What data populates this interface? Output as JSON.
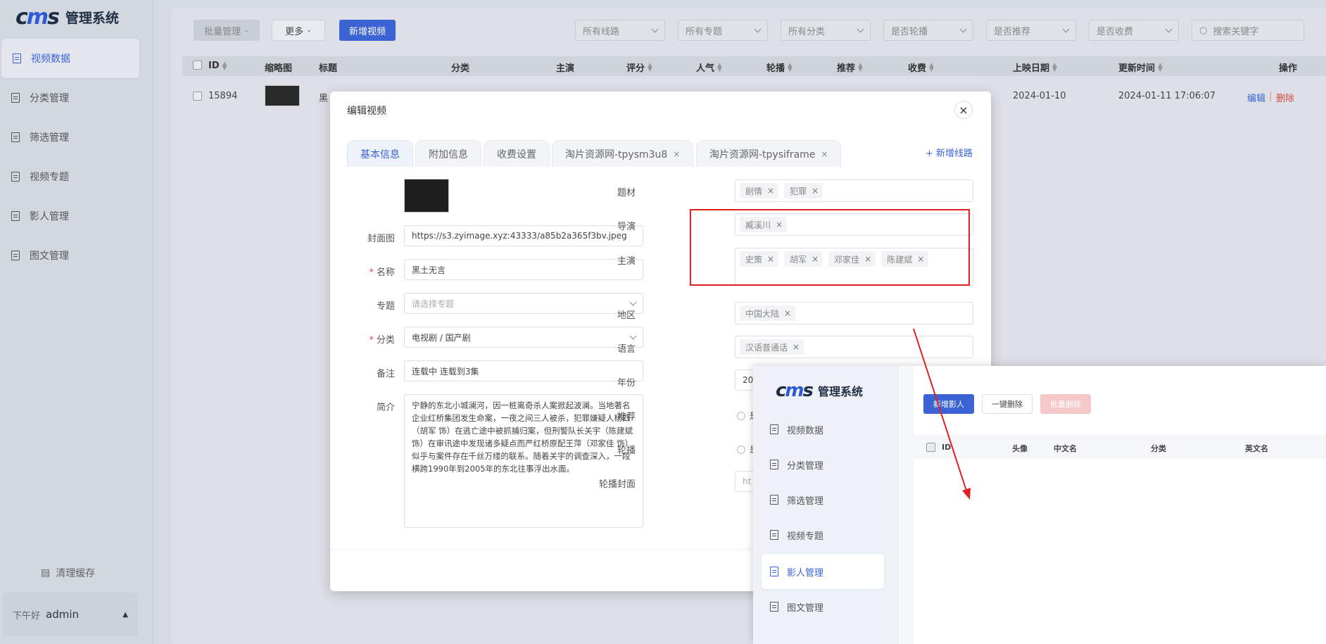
{
  "app": {
    "logo_mark": "cms",
    "title": "管理系统"
  },
  "sidebar": {
    "items": [
      {
        "label": "视频数据"
      },
      {
        "label": "分类管理"
      },
      {
        "label": "筛选管理"
      },
      {
        "label": "视频专题"
      },
      {
        "label": "影人管理"
      },
      {
        "label": "图文管理"
      }
    ],
    "clear_cache": "清理缓存",
    "greeting": "下午好",
    "username": "admin"
  },
  "toolbar": {
    "batch": "批量管理",
    "more": "更多",
    "add_video": "新增视频",
    "filters": [
      "所有线路",
      "所有专题",
      "所有分类",
      "是否轮播",
      "是否推荐",
      "是否收费"
    ],
    "search_placeholder": "搜索关键字"
  },
  "table": {
    "headers": [
      "ID",
      "缩略图",
      "标题",
      "分类",
      "主演",
      "评分",
      "人气",
      "轮播",
      "推荐",
      "收费",
      "上映日期",
      "更新时间",
      "操作"
    ],
    "row": {
      "id": "15894",
      "title_partial": "黑",
      "release_date": "2024-01-10",
      "updated": "2024-01-11 17:06:07",
      "edit": "编辑",
      "divider": "|",
      "delete": "删除"
    }
  },
  "modal": {
    "title": "编辑视频",
    "close": "×",
    "tabs": [
      {
        "label": "基本信息"
      },
      {
        "label": "附加信息"
      },
      {
        "label": "收费设置"
      },
      {
        "label": "淘片资源网-tpysm3u8",
        "close": "×"
      },
      {
        "label": "淘片资源网-tpysiframe",
        "close": "×"
      }
    ],
    "add_line": "+ 新增线路",
    "fields": {
      "cover_label": "封面图",
      "cover_value": "https://s3.zyimage.xyz:43333/a85b2a365f3bv.jpeg",
      "name_label": "名称",
      "name_value": "黑土无言",
      "topic_label": "专题",
      "topic_placeholder": "请选择专题",
      "category_label": "分类",
      "category_value": "电视剧 / 国产剧",
      "remark_label": "备注",
      "remark_value": "连载中 连载到3集",
      "intro_label": "简介",
      "intro_value": "宁静的东北小城澜河，因一桩离奇杀人案掀起波澜。当地著名企业红桥集团发生命案，一夜之间三人被杀，犯罪嫌疑人杨四（胡军 饰）在逃亡途中被抓捕归案，但刑警队长关宇（陈建斌 饰）在审讯途中发现诸多疑点而严红桥原配王萍（邓家佳 饰）似乎与案件存在千丝万缕的联系。随着关宇的调查深入，一段横跨1990年到2005年的东北往事浮出水面。",
      "genre_label": "题材",
      "genre_tags": [
        "剧情",
        "犯罪"
      ],
      "director_label": "导演",
      "director_tags": [
        "臧溪川"
      ],
      "actors_label": "主演",
      "actors_tags": [
        "史策",
        "胡军",
        "邓家佳",
        "陈建斌"
      ],
      "region_label": "地区",
      "region_tags": [
        "中国大陆"
      ],
      "language_label": "语言",
      "language_tags": [
        "汉语普通话"
      ],
      "year_label": "年份",
      "year_partial": "20",
      "recommend_label": "推荐",
      "recommend_partial": "是",
      "carousel_label": "轮播",
      "carousel_partial": "是",
      "carousel_cover_label": "轮播封面",
      "carousel_cover_partial": "ht"
    },
    "tag_close": "×"
  },
  "overlay": {
    "logo_mark": "cms",
    "title": "管理系统",
    "nav": [
      "视频数据",
      "分类管理",
      "筛选管理",
      "视频专题",
      "影人管理",
      "图文管理"
    ],
    "buttons": {
      "add_person": "新增影人",
      "delete_one": "一键删除",
      "batch_delete": "批量删除"
    },
    "headers": [
      "ID",
      "头像",
      "中文名",
      "分类",
      "英文名"
    ]
  },
  "colors": {
    "accent": "#3c63d3",
    "danger": "#d94848",
    "highlight_box": "#e02020",
    "arrow": "#e02020"
  }
}
